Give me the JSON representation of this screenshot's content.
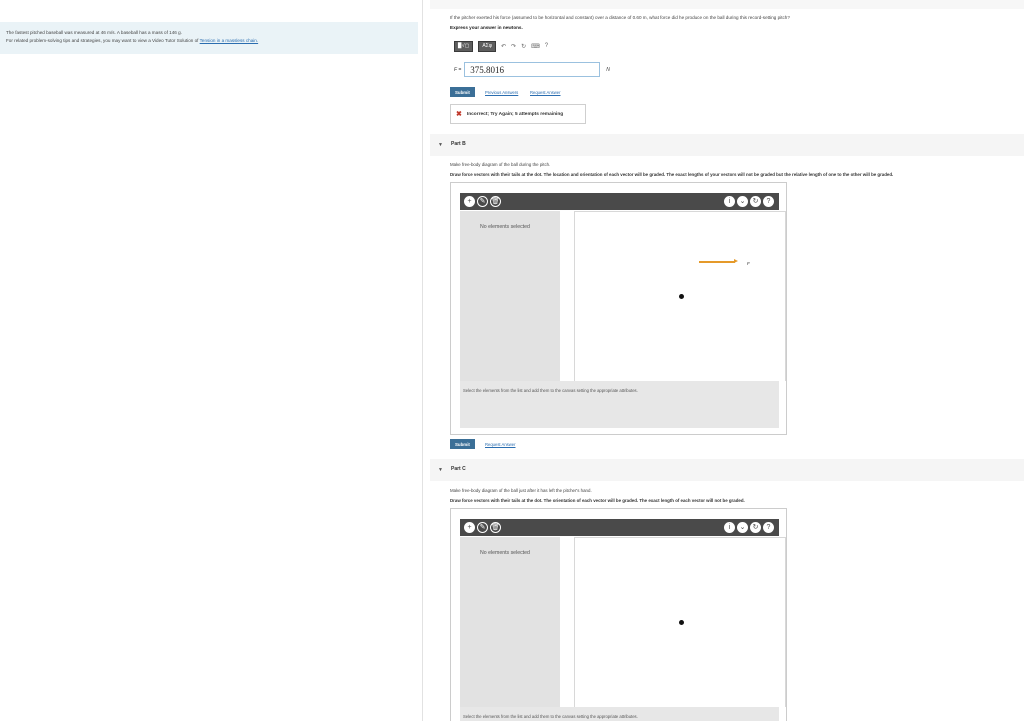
{
  "problem": {
    "line1": "The fastest pitched baseball was measured at 46 m/s. A baseball has a mass of 146 g.",
    "line2_prefix": "For related problem-solving tips and strategies, you may want to view a Video Tutor Solution of ",
    "line2_link": "Tension in a massless chain."
  },
  "part_a": {
    "question": "If the pitcher exerted his force (assumed to be horizontal and constant) over a distance of 0.60 m, what force did he produce on the ball during this record-setting pitch?",
    "express_prefix": "Express your answer in ",
    "express_unit": "newtons",
    "express_suffix": ".",
    "toolbar": {
      "matrix_label": "▉√▢",
      "greek_label": "ΑΣφ"
    },
    "variable_label": "F =",
    "answer_value": "375.8016",
    "unit": "N",
    "submit_label": "Submit",
    "previous_answers_label": "Previous Answers",
    "request_answer_label": "Request Answer",
    "feedback": "Incorrect; Try Again; 5 attempts remaining"
  },
  "part_b": {
    "title": "Part B",
    "instruction": "Make free-body diagram of the ball during the pitch.",
    "instruction_bold": "Draw force vectors with their tails at the dot. The location and orientation of each vector will be graded. The exact lengths of your vectors will not be graded but the relative length of one to the other will be graded.",
    "list_status": "No elements selected",
    "canvas_hint": "Select the elements from the list and add them to the canvas setting the appropriate attributes.",
    "vector_label": "F",
    "submit_label": "Submit",
    "request_answer_label": "Request Answer"
  },
  "part_c": {
    "title": "Part C",
    "instruction": "Make free-body diagram of the ball just after it has left the pitcher's hand.",
    "instruction_bold": "Draw force vectors with their tails at the dot. The orientation of each vector will be graded. The exact length of each vector will not be graded.",
    "list_status": "No elements selected",
    "canvas_hint": "Select the elements from the list and add them to the canvas setting the appropriate attributes."
  },
  "icons": {
    "add": "+",
    "info": "i",
    "help": "?"
  }
}
